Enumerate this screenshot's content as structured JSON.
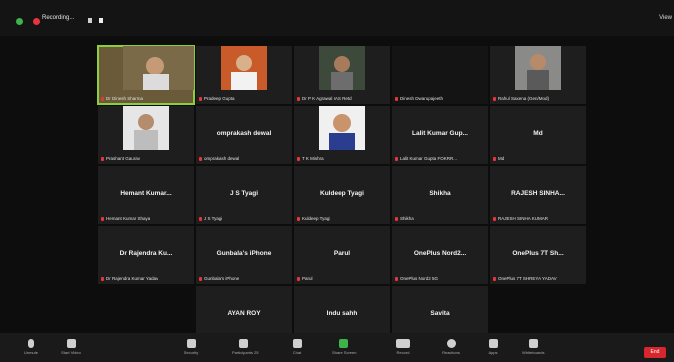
{
  "top_bar": {
    "recording_label": "Recording...",
    "view_label": "View"
  },
  "tiles_row1": [
    {
      "label": "Dr Dinesh Sharma",
      "active": true
    },
    {
      "label": "Pradeep Gupta"
    },
    {
      "label": "Dr P K Agrawal IAS Retd"
    },
    {
      "label": "Dinesh Dwarupajeeth"
    },
    {
      "label": "Rahul Saxena (Gen/Mod)"
    }
  ],
  "tiles_row2": [
    {
      "label": "Prashant Gaurav"
    },
    {
      "name": "omprakash dewal",
      "label": "omprakash dewal"
    },
    {
      "label": "T K Mishra"
    },
    {
      "name": "Lalit Kumar Gup...",
      "label": "Lalit Kumar Gupta FOKRR..."
    },
    {
      "name": "Md",
      "label": "Md"
    }
  ],
  "tiles_row3": [
    {
      "name": "Hemant Kumar...",
      "label": "Hemant Kumar Shaya"
    },
    {
      "name": "J S Tyagi",
      "label": "J S Tyagi"
    },
    {
      "name": "Kuldeep Tyagi",
      "label": "Kuldeep Tyagi"
    },
    {
      "name": "Shikha",
      "label": "Shikha"
    },
    {
      "name": "RAJESH SINHA...",
      "label": "RAJESH SINHA KUMAR"
    }
  ],
  "tiles_row4": [
    {
      "name": "Dr Rajendra Ku...",
      "label": "Dr Rajendra Kumar Yadav"
    },
    {
      "name": "Gunbala's iPhone",
      "label": "Gunbala's iPhone"
    },
    {
      "name": "Parul",
      "label": "Parul"
    },
    {
      "name": "OnePlus Nord2...",
      "label": "OnePlus Nord2 5G"
    },
    {
      "name": "OnePlus 7T Sh...",
      "label": "OnePlus 7T SHREYA YADAV"
    }
  ],
  "tiles_row5": [
    {
      "name": "AYAN ROY",
      "label": "AYAN ROY"
    },
    {
      "name": "Indu sahh",
      "label": "Indu sahh"
    },
    {
      "name": "Savita",
      "label": "Savita"
    }
  ],
  "toolbar": {
    "items": [
      "Unmute",
      "Start Video",
      "Security",
      "Participants",
      "Chat",
      "Share Screen",
      "Record",
      "Reactions",
      "Apps",
      "Whiteboards"
    ],
    "participant_count": "25",
    "end_label": "End"
  }
}
